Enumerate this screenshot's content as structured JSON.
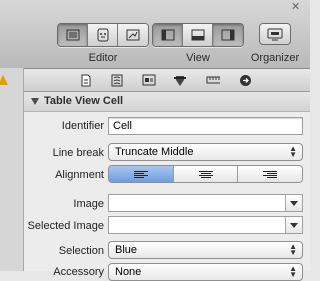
{
  "toolbar": {
    "editor_label": "Editor",
    "view_label": "View",
    "organizer_label": "Organizer",
    "editor_buttons": [
      {
        "icon": "standard-editor-icon",
        "active": true
      },
      {
        "icon": "assistant-editor-icon",
        "active": false
      },
      {
        "icon": "version-editor-icon",
        "active": false
      }
    ],
    "view_buttons": [
      {
        "icon": "navigator-toggle-icon",
        "active": true
      },
      {
        "icon": "debug-area-toggle-icon",
        "active": false
      },
      {
        "icon": "utilities-toggle-icon",
        "active": true
      }
    ],
    "organizer_icon": "organizer-icon"
  },
  "inspector_tabs": [
    "file-inspector-icon",
    "quick-help-icon",
    "identity-inspector-icon",
    "attributes-inspector-icon",
    "size-inspector-icon",
    "connections-inspector-icon"
  ],
  "section": {
    "title": "Table View Cell"
  },
  "fields": {
    "identifier_label": "Identifier",
    "identifier_value": "Cell",
    "line_break_label": "Line break",
    "line_break_value": "Truncate Middle",
    "alignment_label": "Alignment",
    "alignment_selected": "left",
    "image_label": "Image",
    "image_value": "",
    "selected_image_label": "Selected Image",
    "selected_image_value": "",
    "selection_label": "Selection",
    "selection_value": "Blue",
    "accessory_label": "Accessory",
    "accessory_value": "None"
  },
  "colors": {
    "selected_segment": "#6f9ee0",
    "warning": "#e0a100"
  }
}
